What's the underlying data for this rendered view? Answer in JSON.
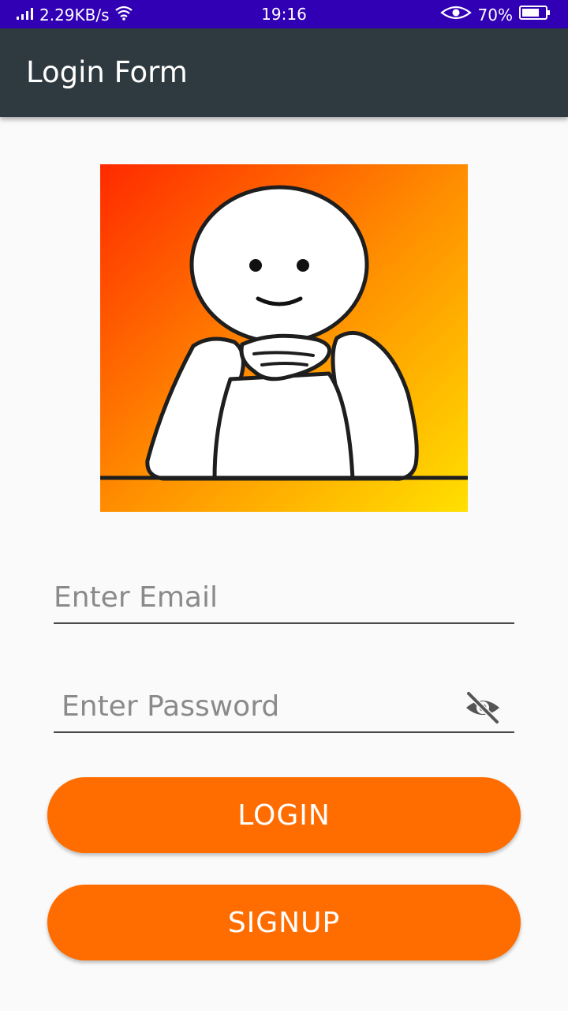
{
  "status_bar": {
    "network_speed": "2.29KB/s",
    "time": "19:16",
    "battery": "70%",
    "icons": [
      "signal-icon",
      "wifi-icon",
      "eye-icon",
      "battery-icon"
    ]
  },
  "app_bar": {
    "title": "Login Form"
  },
  "form": {
    "email_placeholder": "Enter Email",
    "email_value": "",
    "password_placeholder": "Enter Password",
    "password_value": "",
    "password_toggle_icon": "visibility-off-icon",
    "login_label": "LOGIN",
    "signup_label": "SIGNUP"
  },
  "colors": {
    "status_bar": "#3200b4",
    "app_bar": "#2f3a40",
    "accent": "#ff6d00",
    "logo_gradient_start": "#ff2a00",
    "logo_gradient_end": "#ffe000"
  }
}
